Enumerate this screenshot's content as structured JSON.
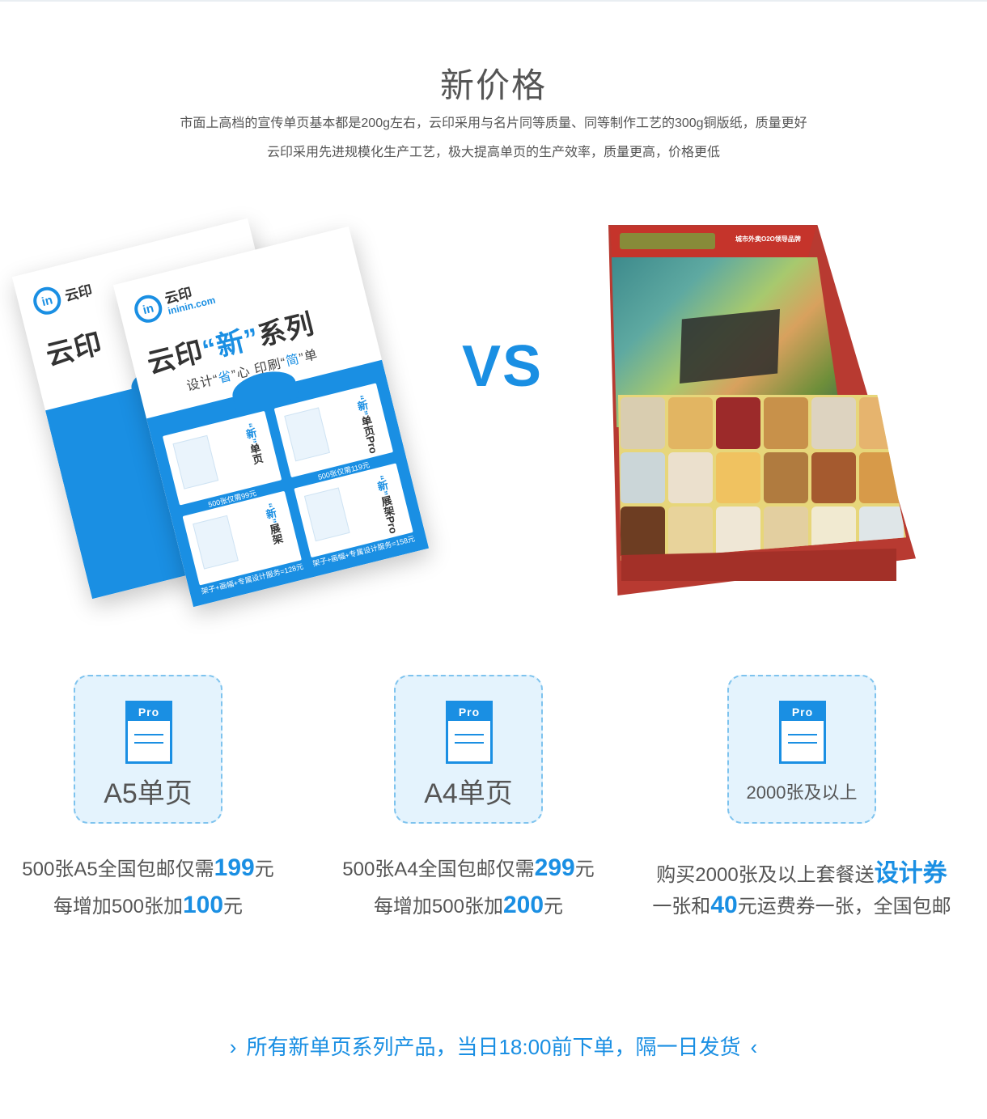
{
  "header": {
    "title": "新价格",
    "subtitle_line1": "市面上高档的宣传单页基本都是200g左右，云印采用与名片同等质量、同等制作工艺的300g铜版纸，质量更好",
    "subtitle_line2": "云印采用先进规模化生产工艺，极大提高单页的生产效率，质量更高，价格更低"
  },
  "comparison": {
    "vs_label": "VS",
    "flyer": {
      "brand_icon_text": "in",
      "brand_name": "云印",
      "brand_url": "ininin.com",
      "headline_pre": "云印",
      "headline_hl": "“新”",
      "headline_post": "系列",
      "slogan_parts": [
        "设计“",
        "省",
        "”心  印刷“",
        "简",
        "”单"
      ],
      "cards": [
        {
          "title_hl": "“新”",
          "title": "单页",
          "price": "500张仅需99元"
        },
        {
          "title_hl": "“新”",
          "title": "单页Pro",
          "price": "500张仅需119元"
        },
        {
          "title_hl": "“新”",
          "title": "展架",
          "price": "架子+画幅+专属设计服务=128元"
        },
        {
          "title_hl": "“新”",
          "title": "展架Pro",
          "price": "架子+画幅+专属设计服务=158元"
        }
      ]
    },
    "magazine": {
      "tag": "城市外卖O2O领导品牌"
    }
  },
  "packages": [
    {
      "icon_badge": "Pro",
      "label": "A5单页",
      "line1_pre": "500张A5全国包邮仅需",
      "line1_num": "199",
      "line1_post": "元",
      "line2_pre": "每增加500张加",
      "line2_num": "100",
      "line2_post": "元"
    },
    {
      "icon_badge": "Pro",
      "label": "A4单页",
      "line1_pre": "500张A4全国包邮仅需",
      "line1_num": "299",
      "line1_post": "元",
      "line2_pre": "每增加500张加",
      "line2_num": "200",
      "line2_post": "元"
    },
    {
      "icon_badge": "Pro",
      "label": "2000张及以上",
      "line1_pre": "购买2000张及以上套餐送",
      "line1_num": "设计券",
      "line1_post": "",
      "line2_pre": "一张和",
      "line2_num": "40",
      "line2_post": "元运费券一张，全国包邮"
    }
  ],
  "footer": {
    "chevron_left": "›",
    "text": "所有新单页系列产品，当日18:00前下单，隔一日发货",
    "chevron_right": "‹"
  },
  "colors": {
    "accent": "#1a8fe3",
    "package_bg": "#e4f3fd",
    "package_border": "#7ec3ee",
    "magazine_red": "#b83a31"
  }
}
